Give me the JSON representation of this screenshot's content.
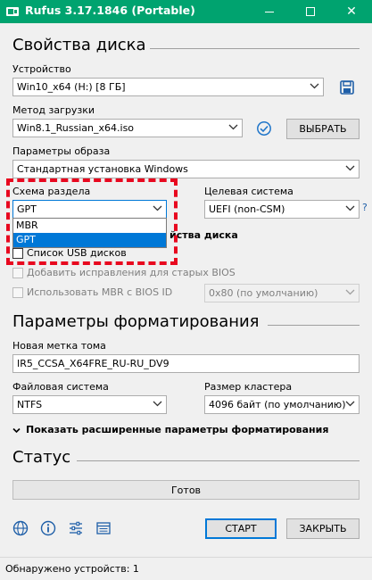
{
  "window": {
    "title": "Rufus 3.17.1846 (Portable)",
    "accent": "#00a36f"
  },
  "drive_properties": {
    "heading": "Свойства диска",
    "device_label": "Устройство",
    "device_value": "Win10_x64 (H:) [8 ГБ]",
    "boot_method_label": "Метод загрузки",
    "boot_method_value": "Win8.1_Russian_x64.iso",
    "select_button": "ВЫБРАТЬ",
    "image_options_label": "Параметры образа",
    "image_options_value": "Стандартная установка Windows",
    "partition_scheme_label": "Схема раздела",
    "partition_scheme_value": "GPT",
    "partition_scheme_options": [
      "MBR",
      "GPT"
    ],
    "target_system_label": "Целевая система",
    "target_system_value": "UEFI (non-CSM)",
    "help_mark": "?",
    "advanced_toggle_partial": "йства диска",
    "list_usb_label": "Список USB дисков",
    "bios_fixes_label": "Добавить исправления для старых BIOS",
    "use_mbr_label": "Использовать MBR с BIOS ID",
    "bios_id_value": "0x80 (по умолчанию)"
  },
  "format_options": {
    "heading": "Параметры форматирования",
    "volume_label_label": "Новая метка тома",
    "volume_label_value": "IR5_CCSA_X64FRE_RU-RU_DV9",
    "file_system_label": "Файловая система",
    "file_system_value": "NTFS",
    "cluster_size_label": "Размер кластера",
    "cluster_size_value": "4096 байт (по умолчанию)",
    "advanced_toggle": "Показать расширенные параметры форматирования"
  },
  "status": {
    "heading": "Статус",
    "state": "Готов"
  },
  "actions": {
    "start_button": "СТАРТ",
    "close_button": "ЗАКРЫТЬ"
  },
  "footer": {
    "devices_found": "Обнаружено устройств: 1"
  },
  "icons": {
    "save": "save-icon",
    "verify": "check-circle-icon",
    "globe": "globe-icon",
    "info": "info-icon",
    "settings": "settings-sliders-icon",
    "log": "log-icon"
  },
  "colors": {
    "selection": "#0078d7",
    "annotation": "#e8081f"
  }
}
